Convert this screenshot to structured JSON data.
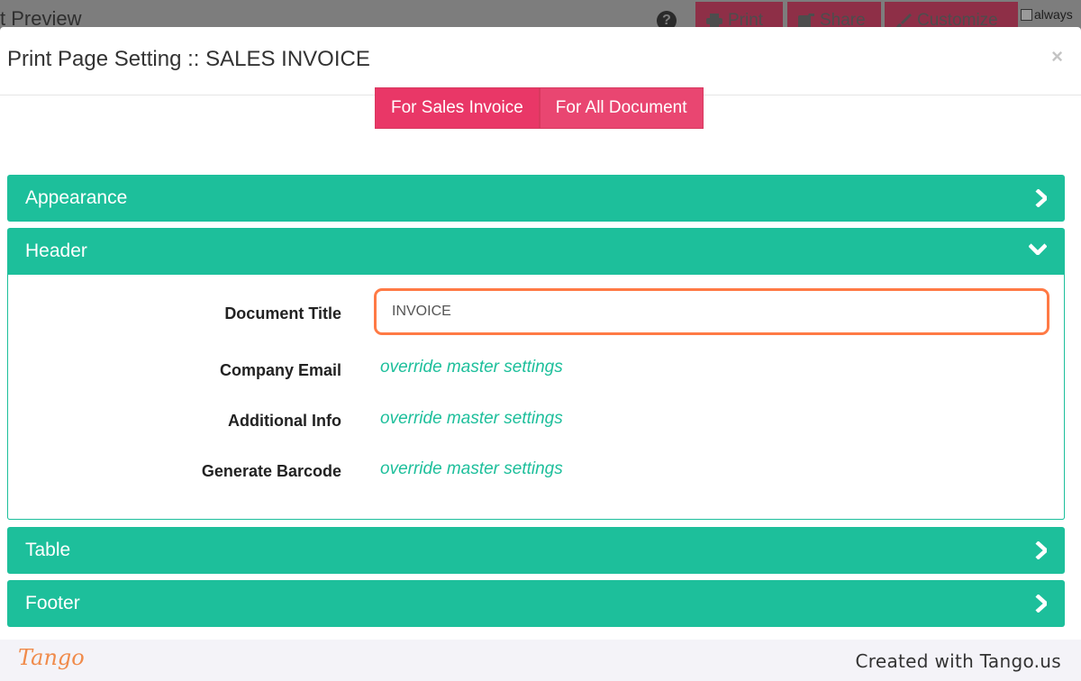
{
  "background": {
    "title_partial": "t Preview",
    "print_label": "Print",
    "share_label": "Share",
    "customize_label": "Customize",
    "always_label": "always"
  },
  "modal": {
    "title": "Print Page Setting :: SALES INVOICE",
    "close_label": "×",
    "toggles": [
      {
        "label": "For Sales Invoice",
        "active": true
      },
      {
        "label": "For All Document",
        "active": false
      }
    ],
    "panels": {
      "appearance": {
        "label": "Appearance",
        "expanded": false
      },
      "header": {
        "label": "Header",
        "expanded": true,
        "document_title_label": "Document Title",
        "document_title_value": "INVOICE",
        "company_email_label": "Company Email",
        "additional_info_label": "Additional Info",
        "generate_barcode_label": "Generate Barcode",
        "override_label": "override master settings"
      },
      "table": {
        "label": "Table",
        "expanded": false
      },
      "footer": {
        "label": "Footer",
        "expanded": false
      }
    }
  },
  "footer": {
    "logo": "Tango",
    "created": "Created with Tango.us"
  },
  "colors": {
    "teal": "#1dbf9b",
    "pink": "#e94671",
    "highlight": "#ff7a45"
  }
}
